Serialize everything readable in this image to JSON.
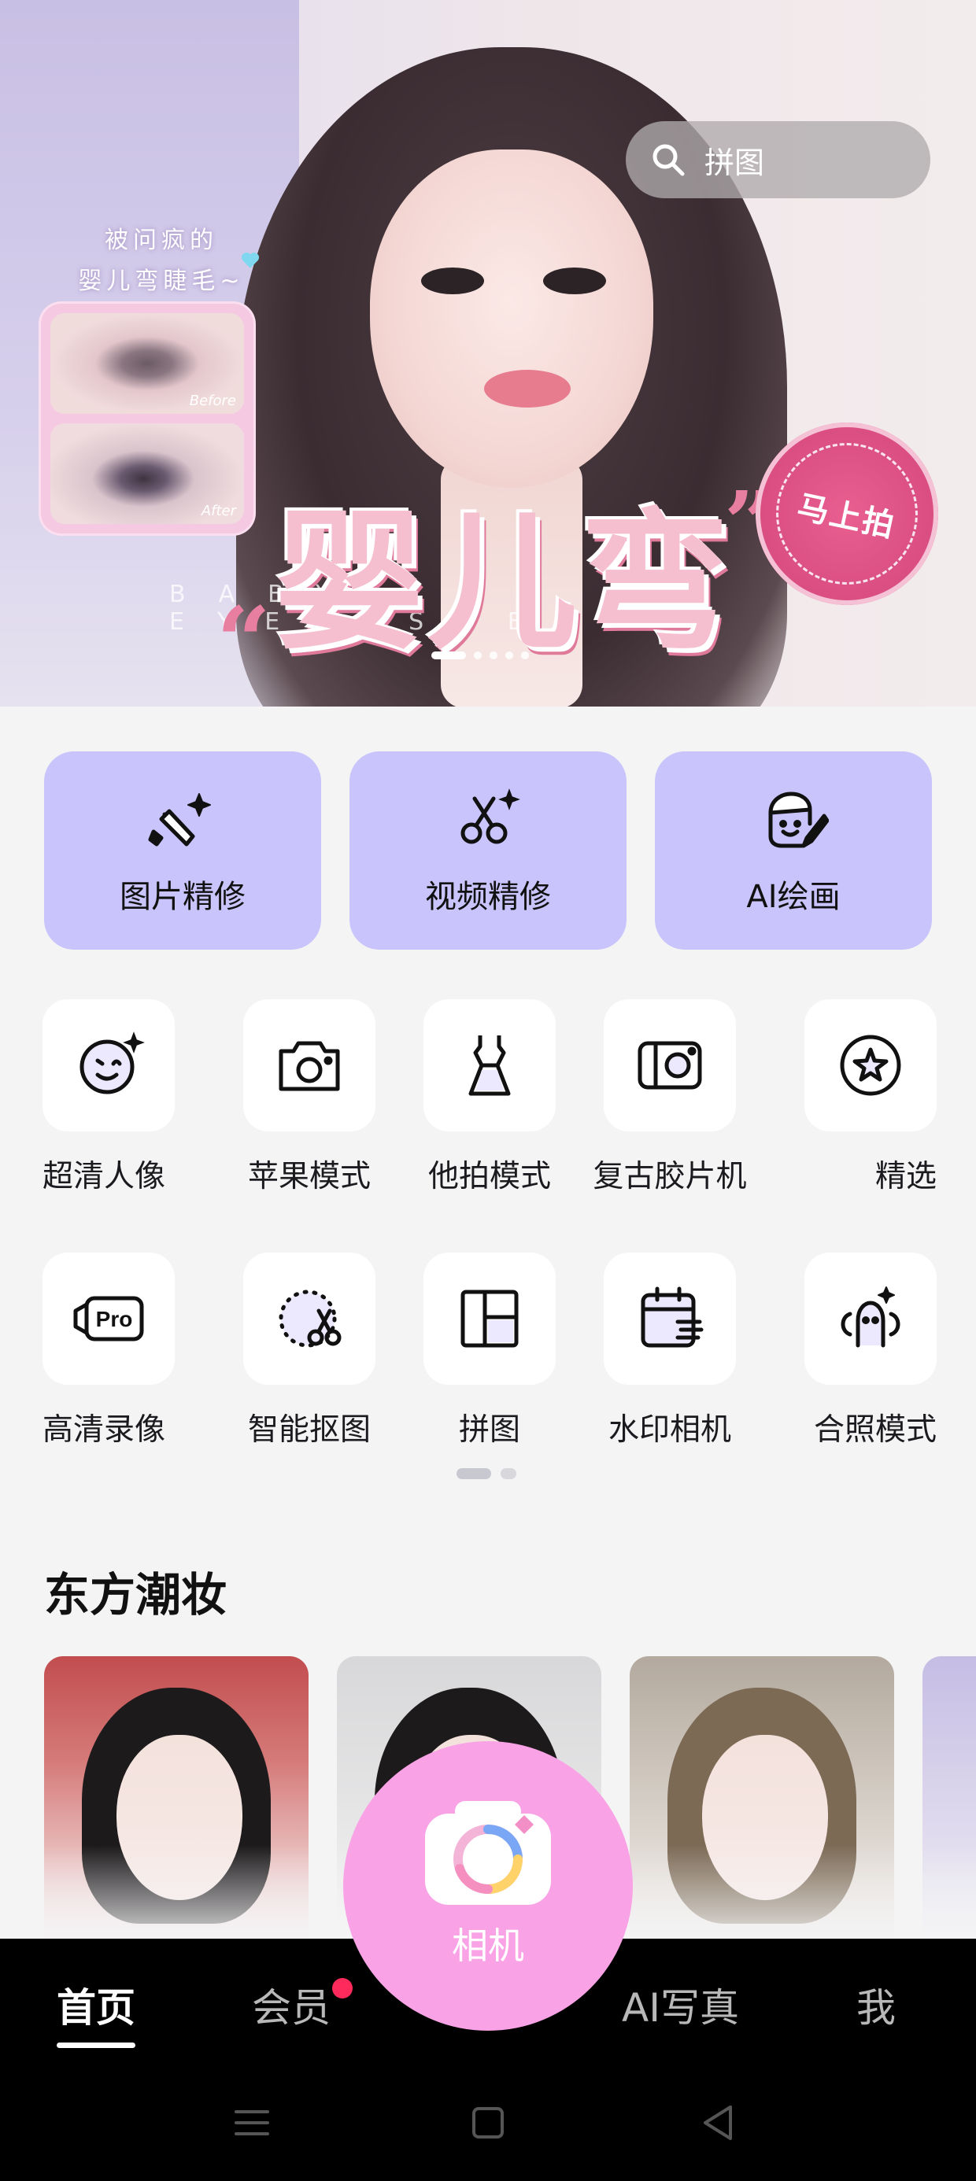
{
  "banner": {
    "search_placeholder": "拼图",
    "promo_line1": "被问疯的",
    "promo_line2": "婴儿弯睫毛~",
    "before_label": "Before",
    "after_label": "After",
    "title": "婴儿弯",
    "subtitle_en": "BABY EYELASHES",
    "badge": "马上拍",
    "slide_count": 5,
    "active_slide": 1
  },
  "main_cards": [
    {
      "label": "图片精修",
      "icon": "retouch-brush-icon"
    },
    {
      "label": "视频精修",
      "icon": "video-scissors-icon"
    },
    {
      "label": "AI绘画",
      "icon": "ai-painting-icon"
    }
  ],
  "tools_row1": [
    {
      "label": "超清人像",
      "icon": "hd-portrait-face-icon"
    },
    {
      "label": "苹果模式",
      "icon": "camera-icon"
    },
    {
      "label": "他拍模式",
      "icon": "dress-icon"
    },
    {
      "label": "复古胶片机",
      "icon": "film-camera-icon"
    },
    {
      "label": "精选",
      "icon": "star-circle-icon"
    }
  ],
  "tools_row2": [
    {
      "label": "高清录像",
      "icon": "pro-video-icon"
    },
    {
      "label": "智能抠图",
      "icon": "smart-cutout-icon"
    },
    {
      "label": "拼图",
      "icon": "collage-grid-icon"
    },
    {
      "label": "水印相机",
      "icon": "watermark-calendar-icon"
    },
    {
      "label": "合照模式",
      "icon": "group-photo-icon"
    }
  ],
  "tool_pages": {
    "count": 2,
    "active": 1
  },
  "section": {
    "title": "东方潮妆"
  },
  "camera_button": {
    "label": "相机"
  },
  "tab_bar": {
    "home": "首页",
    "vip": "会员",
    "ai_photo": "AI写真",
    "me": "我",
    "active": "home"
  },
  "colors": {
    "card_purple": "#c9c4fb",
    "camera_pink": "#f9a3e6",
    "badge_pink": "#e85f90",
    "notification_red": "#ff2a5c"
  }
}
